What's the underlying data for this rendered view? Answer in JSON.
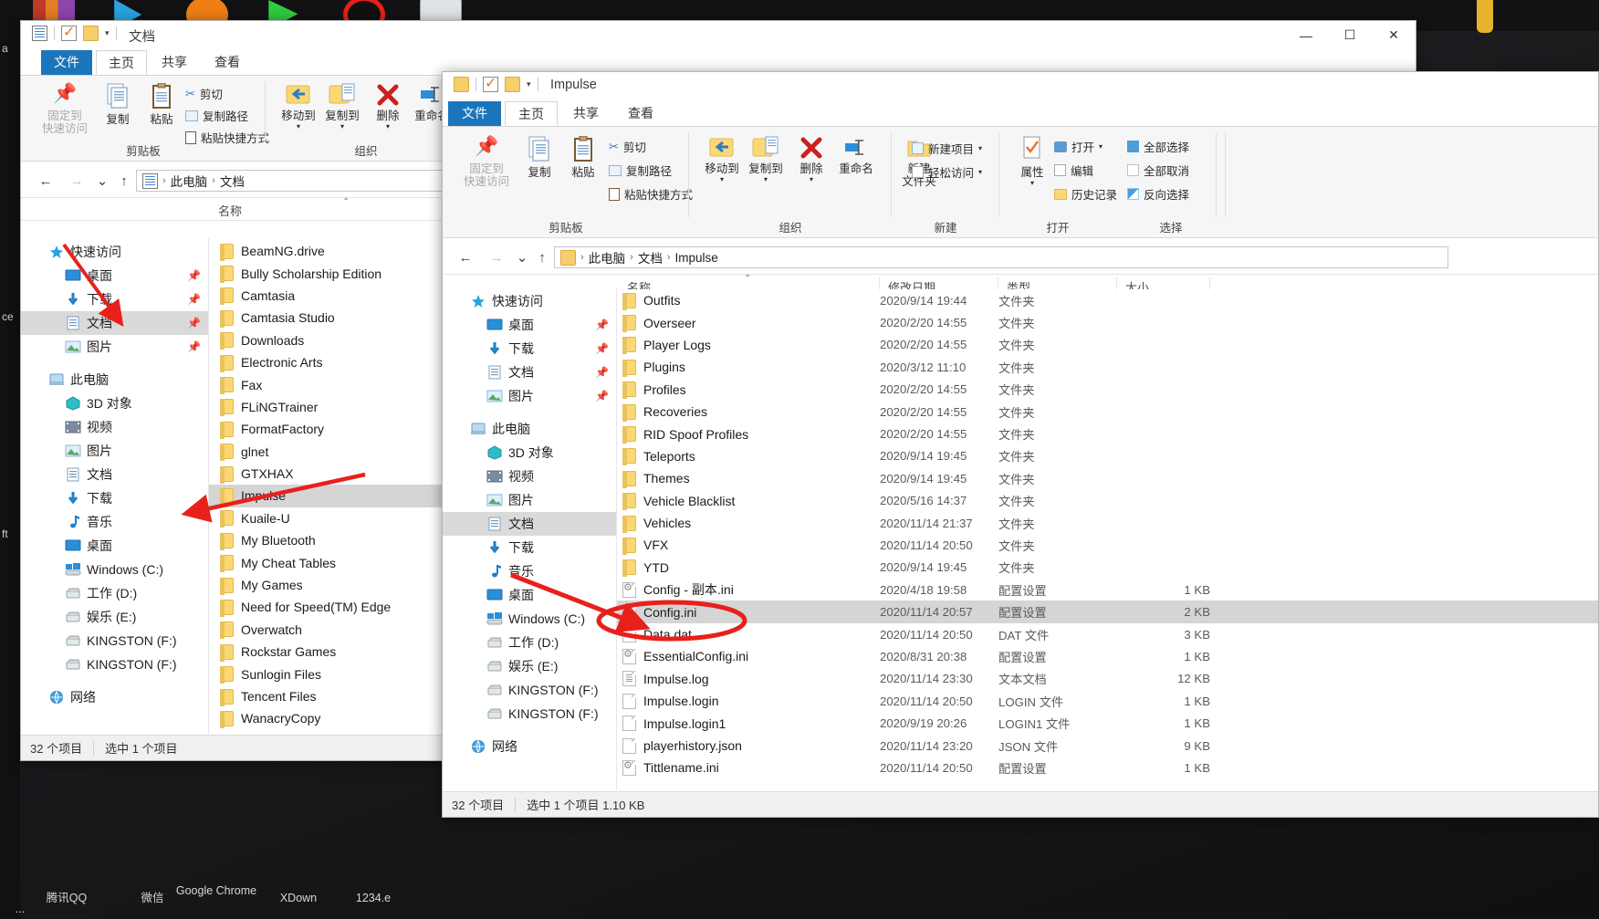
{
  "desktop": {
    "taskbar_items": [
      {
        "label": "腾讯QQ"
      },
      {
        "label": "微信"
      },
      {
        "label": "Google Chrome"
      },
      {
        "label": "XDown"
      },
      {
        "label": "1234.e"
      },
      {
        "label": "..."
      }
    ],
    "side_labels": [
      "a",
      "ce",
      "ft"
    ]
  },
  "window_left": {
    "title": "文档",
    "qat_icons": [
      "document-icon",
      "checkbox-icon",
      "folder-icon",
      "chevron-down-icon"
    ],
    "window_buttons": {
      "minimize": "—",
      "maximize": "☐",
      "close": "✕"
    },
    "tabs": [
      {
        "label": "文件",
        "type": "file"
      },
      {
        "label": "主页",
        "type": "active"
      },
      {
        "label": "共享",
        "type": "normal"
      },
      {
        "label": "查看",
        "type": "normal"
      }
    ],
    "ribbon": {
      "groups": [
        {
          "name": "剪贴板",
          "big_buttons": [
            {
              "label": "固定到\n快速访问",
              "icon": "pin-icon",
              "disabled": true
            },
            {
              "label": "复制",
              "icon": "copy-icon"
            },
            {
              "label": "粘贴",
              "icon": "paste-icon"
            }
          ],
          "small_buttons": [
            {
              "label": "剪切",
              "icon": "scissors-icon"
            },
            {
              "label": "复制路径",
              "icon": "copy-path-icon"
            },
            {
              "label": "粘贴快捷方式",
              "icon": "paste-shortcut-icon"
            }
          ]
        },
        {
          "name": "组织",
          "big_buttons": [
            {
              "label": "移动到",
              "icon": "move-to-icon"
            },
            {
              "label": "复制到",
              "icon": "copy-to-icon"
            },
            {
              "label": "删除",
              "icon": "delete-icon"
            },
            {
              "label": "重命名",
              "icon": "rename-icon"
            }
          ],
          "small_buttons": []
        }
      ]
    },
    "breadcrumb": {
      "root_icon": "computer-icon",
      "segments": [
        "此电脑",
        "文档"
      ]
    },
    "nav_buttons": {
      "back": "←",
      "forward": "→",
      "recent": "⌄",
      "up": "↑"
    },
    "columns": [
      {
        "label": "名称"
      }
    ],
    "nav_pane": [
      {
        "label": "快速访问",
        "icon": "star-icon",
        "level": 0,
        "pinned": false,
        "selected": false
      },
      {
        "label": "桌面",
        "icon": "desktop-icon",
        "level": 1,
        "pinned": true,
        "selected": false
      },
      {
        "label": "下载",
        "icon": "download-icon",
        "level": 1,
        "pinned": true,
        "selected": false
      },
      {
        "label": "文档",
        "icon": "documents-icon",
        "level": 1,
        "pinned": true,
        "selected": true
      },
      {
        "label": "图片",
        "icon": "pictures-icon",
        "level": 1,
        "pinned": true,
        "selected": false
      },
      {
        "label": "此电脑",
        "icon": "computer-icon",
        "level": 0,
        "pinned": false,
        "selected": false
      },
      {
        "label": "3D 对象",
        "icon": "3d-objects-icon",
        "level": 1,
        "pinned": false,
        "selected": false
      },
      {
        "label": "视频",
        "icon": "videos-icon",
        "level": 1,
        "pinned": false,
        "selected": false
      },
      {
        "label": "图片",
        "icon": "pictures-icon",
        "level": 1,
        "pinned": false,
        "selected": false
      },
      {
        "label": "文档",
        "icon": "documents-icon",
        "level": 1,
        "pinned": false,
        "selected": false
      },
      {
        "label": "下载",
        "icon": "download-icon",
        "level": 1,
        "pinned": false,
        "selected": false
      },
      {
        "label": "音乐",
        "icon": "music-icon",
        "level": 1,
        "pinned": false,
        "selected": false
      },
      {
        "label": "桌面",
        "icon": "desktop-icon",
        "level": 1,
        "pinned": false,
        "selected": false
      },
      {
        "label": "Windows (C:)",
        "icon": "windows-drive-icon",
        "level": 1,
        "pinned": false,
        "selected": false
      },
      {
        "label": "工作 (D:)",
        "icon": "drive-icon",
        "level": 1,
        "pinned": false,
        "selected": false
      },
      {
        "label": "娱乐 (E:)",
        "icon": "drive-icon",
        "level": 1,
        "pinned": false,
        "selected": false
      },
      {
        "label": "KINGSTON (F:)",
        "icon": "drive-icon",
        "level": 1,
        "pinned": false,
        "selected": false
      },
      {
        "label": "KINGSTON (F:)",
        "icon": "drive-icon",
        "level": 1,
        "pinned": false,
        "selected": false
      },
      {
        "label": "网络",
        "icon": "network-icon",
        "level": 0,
        "pinned": false,
        "selected": false
      }
    ],
    "files": [
      {
        "name": "BeamNG.drive",
        "icon": "folder",
        "selected": false
      },
      {
        "name": "Bully Scholarship Edition",
        "icon": "folder",
        "selected": false
      },
      {
        "name": "Camtasia",
        "icon": "folder",
        "selected": false
      },
      {
        "name": "Camtasia Studio",
        "icon": "folder",
        "selected": false
      },
      {
        "name": "Downloads",
        "icon": "folder",
        "selected": false
      },
      {
        "name": "Electronic Arts",
        "icon": "folder",
        "selected": false
      },
      {
        "name": "Fax",
        "icon": "folder",
        "selected": false
      },
      {
        "name": "FLiNGTrainer",
        "icon": "folder",
        "selected": false
      },
      {
        "name": "FormatFactory",
        "icon": "folder",
        "selected": false
      },
      {
        "name": "glnet",
        "icon": "folder",
        "selected": false
      },
      {
        "name": "GTXHAX",
        "icon": "folder",
        "selected": false
      },
      {
        "name": "Impulse",
        "icon": "folder",
        "selected": true
      },
      {
        "name": "Kuaile-U",
        "icon": "folder",
        "selected": false
      },
      {
        "name": "My Bluetooth",
        "icon": "folder",
        "selected": false
      },
      {
        "name": "My Cheat Tables",
        "icon": "folder",
        "selected": false
      },
      {
        "name": "My Games",
        "icon": "folder",
        "selected": false
      },
      {
        "name": "Need for Speed(TM) Edge",
        "icon": "folder",
        "selected": false
      },
      {
        "name": "Overwatch",
        "icon": "folder",
        "selected": false
      },
      {
        "name": "Rockstar Games",
        "icon": "folder",
        "selected": false
      },
      {
        "name": "Sunlogin Files",
        "icon": "folder",
        "selected": false
      },
      {
        "name": "Tencent Files",
        "icon": "folder",
        "selected": false
      },
      {
        "name": "WanacryCopy",
        "icon": "folder",
        "selected": false
      }
    ],
    "status": {
      "count": "32 个项目",
      "selection": "选中 1 个项目"
    }
  },
  "window_right": {
    "title": "Impulse",
    "qat_icons": [
      "folder-icon",
      "checkbox-icon",
      "folder-icon",
      "chevron-down-icon"
    ],
    "tabs": [
      {
        "label": "文件",
        "type": "file"
      },
      {
        "label": "主页",
        "type": "active"
      },
      {
        "label": "共享",
        "type": "normal"
      },
      {
        "label": "查看",
        "type": "normal"
      }
    ],
    "ribbon": {
      "groups": [
        {
          "name": "剪贴板",
          "big_buttons": [
            {
              "label": "固定到\n快速访问",
              "icon": "pin-icon",
              "disabled": true
            },
            {
              "label": "复制",
              "icon": "copy-icon"
            },
            {
              "label": "粘贴",
              "icon": "paste-icon"
            }
          ],
          "small_buttons": [
            {
              "label": "剪切",
              "icon": "scissors-icon"
            },
            {
              "label": "复制路径",
              "icon": "copy-path-icon"
            },
            {
              "label": "粘贴快捷方式",
              "icon": "paste-shortcut-icon"
            }
          ]
        },
        {
          "name": "组织",
          "big_buttons": [
            {
              "label": "移动到",
              "icon": "move-to-icon"
            },
            {
              "label": "复制到",
              "icon": "copy-to-icon"
            },
            {
              "label": "删除",
              "icon": "delete-icon"
            },
            {
              "label": "重命名",
              "icon": "rename-icon"
            }
          ],
          "small_buttons": []
        },
        {
          "name": "新建",
          "big_buttons": [
            {
              "label": "新建\n文件夹",
              "icon": "new-folder-icon"
            }
          ],
          "small_buttons": [
            {
              "label": "新建项目",
              "icon": "new-item-icon",
              "caret": true
            },
            {
              "label": "轻松访问",
              "icon": "easy-access-icon",
              "caret": true
            }
          ]
        },
        {
          "name": "打开",
          "big_buttons": [
            {
              "label": "属性",
              "icon": "properties-icon"
            }
          ],
          "small_buttons": [
            {
              "label": "打开",
              "icon": "open-icon",
              "caret": true
            },
            {
              "label": "编辑",
              "icon": "edit-icon"
            },
            {
              "label": "历史记录",
              "icon": "history-icon"
            }
          ]
        },
        {
          "name": "选择",
          "big_buttons": [],
          "small_buttons": [
            {
              "label": "全部选择",
              "icon": "select-all-icon"
            },
            {
              "label": "全部取消",
              "icon": "select-none-icon"
            },
            {
              "label": "反向选择",
              "icon": "invert-selection-icon"
            }
          ]
        }
      ]
    },
    "breadcrumb": {
      "root_icon": "folder-icon",
      "segments": [
        "此电脑",
        "文档",
        "Impulse"
      ]
    },
    "nav_buttons": {
      "back": "←",
      "forward": "→",
      "recent": "⌄",
      "up": "↑"
    },
    "columns": [
      {
        "label": "名称"
      },
      {
        "label": "修改日期"
      },
      {
        "label": "类型"
      },
      {
        "label": "大小"
      }
    ],
    "nav_pane": [
      {
        "label": "快速访问",
        "icon": "star-icon",
        "level": 0,
        "pinned": false,
        "selected": false
      },
      {
        "label": "桌面",
        "icon": "desktop-icon",
        "level": 1,
        "pinned": true,
        "selected": false
      },
      {
        "label": "下载",
        "icon": "download-icon",
        "level": 1,
        "pinned": true,
        "selected": false
      },
      {
        "label": "文档",
        "icon": "documents-icon",
        "level": 1,
        "pinned": true,
        "selected": false
      },
      {
        "label": "图片",
        "icon": "pictures-icon",
        "level": 1,
        "pinned": true,
        "selected": false
      },
      {
        "label": "此电脑",
        "icon": "computer-icon",
        "level": 0,
        "pinned": false,
        "selected": false
      },
      {
        "label": "3D 对象",
        "icon": "3d-objects-icon",
        "level": 1,
        "pinned": false,
        "selected": false
      },
      {
        "label": "视频",
        "icon": "videos-icon",
        "level": 1,
        "pinned": false,
        "selected": false
      },
      {
        "label": "图片",
        "icon": "pictures-icon",
        "level": 1,
        "pinned": false,
        "selected": false
      },
      {
        "label": "文档",
        "icon": "documents-icon",
        "level": 1,
        "pinned": false,
        "selected": true
      },
      {
        "label": "下载",
        "icon": "download-icon",
        "level": 1,
        "pinned": false,
        "selected": false
      },
      {
        "label": "音乐",
        "icon": "music-icon",
        "level": 1,
        "pinned": false,
        "selected": false
      },
      {
        "label": "桌面",
        "icon": "desktop-icon",
        "level": 1,
        "pinned": false,
        "selected": false
      },
      {
        "label": "Windows (C:)",
        "icon": "windows-drive-icon",
        "level": 1,
        "pinned": false,
        "selected": false
      },
      {
        "label": "工作 (D:)",
        "icon": "drive-icon",
        "level": 1,
        "pinned": false,
        "selected": false
      },
      {
        "label": "娱乐 (E:)",
        "icon": "drive-icon",
        "level": 1,
        "pinned": false,
        "selected": false
      },
      {
        "label": "KINGSTON (F:)",
        "icon": "drive-icon",
        "level": 1,
        "pinned": false,
        "selected": false
      },
      {
        "label": "KINGSTON (F:)",
        "icon": "drive-icon",
        "level": 1,
        "pinned": false,
        "selected": false
      },
      {
        "label": "网络",
        "icon": "network-icon",
        "level": 0,
        "pinned": false,
        "selected": false
      }
    ],
    "files": [
      {
        "name": "Outfits",
        "date": "2020/9/14 19:44",
        "type": "文件夹",
        "size": "",
        "icon": "folder",
        "selected": false
      },
      {
        "name": "Overseer",
        "date": "2020/2/20 14:55",
        "type": "文件夹",
        "size": "",
        "icon": "folder",
        "selected": false
      },
      {
        "name": "Player Logs",
        "date": "2020/2/20 14:55",
        "type": "文件夹",
        "size": "",
        "icon": "folder",
        "selected": false
      },
      {
        "name": "Plugins",
        "date": "2020/3/12 11:10",
        "type": "文件夹",
        "size": "",
        "icon": "folder",
        "selected": false
      },
      {
        "name": "Profiles",
        "date": "2020/2/20 14:55",
        "type": "文件夹",
        "size": "",
        "icon": "folder",
        "selected": false
      },
      {
        "name": "Recoveries",
        "date": "2020/2/20 14:55",
        "type": "文件夹",
        "size": "",
        "icon": "folder",
        "selected": false
      },
      {
        "name": "RID Spoof Profiles",
        "date": "2020/2/20 14:55",
        "type": "文件夹",
        "size": "",
        "icon": "folder",
        "selected": false
      },
      {
        "name": "Teleports",
        "date": "2020/9/14 19:45",
        "type": "文件夹",
        "size": "",
        "icon": "folder",
        "selected": false
      },
      {
        "name": "Themes",
        "date": "2020/9/14 19:45",
        "type": "文件夹",
        "size": "",
        "icon": "folder",
        "selected": false
      },
      {
        "name": "Vehicle Blacklist",
        "date": "2020/5/16 14:37",
        "type": "文件夹",
        "size": "",
        "icon": "folder",
        "selected": false
      },
      {
        "name": "Vehicles",
        "date": "2020/11/14 21:37",
        "type": "文件夹",
        "size": "",
        "icon": "folder",
        "selected": false
      },
      {
        "name": "VFX",
        "date": "2020/11/14 20:50",
        "type": "文件夹",
        "size": "",
        "icon": "folder",
        "selected": false
      },
      {
        "name": "YTD",
        "date": "2020/9/14 19:45",
        "type": "文件夹",
        "size": "",
        "icon": "folder",
        "selected": false
      },
      {
        "name": "Config - 副本.ini",
        "date": "2020/4/18 19:58",
        "type": "配置设置",
        "size": "1 KB",
        "icon": "ini",
        "selected": false
      },
      {
        "name": "Config.ini",
        "date": "2020/11/14 20:57",
        "type": "配置设置",
        "size": "2 KB",
        "icon": "ini",
        "selected": true
      },
      {
        "name": "Data.dat",
        "date": "2020/11/14 20:50",
        "type": "DAT 文件",
        "size": "3 KB",
        "icon": "file",
        "selected": false
      },
      {
        "name": "EssentialConfig.ini",
        "date": "2020/8/31 20:38",
        "type": "配置设置",
        "size": "1 KB",
        "icon": "ini",
        "selected": false
      },
      {
        "name": "Impulse.log",
        "date": "2020/11/14 23:30",
        "type": "文本文档",
        "size": "12 KB",
        "icon": "txt",
        "selected": false
      },
      {
        "name": "Impulse.login",
        "date": "2020/11/14 20:50",
        "type": "LOGIN 文件",
        "size": "1 KB",
        "icon": "file",
        "selected": false
      },
      {
        "name": "Impulse.login1",
        "date": "2020/9/19 20:26",
        "type": "LOGIN1 文件",
        "size": "1 KB",
        "icon": "file",
        "selected": false
      },
      {
        "name": "playerhistory.json",
        "date": "2020/11/14 23:20",
        "type": "JSON 文件",
        "size": "9 KB",
        "icon": "file",
        "selected": false
      },
      {
        "name": "Tittlename.ini",
        "date": "2020/11/14 20:50",
        "type": "配置设置",
        "size": "1 KB",
        "icon": "ini",
        "selected": false
      }
    ],
    "status": {
      "count": "32 个项目",
      "selection": "选中 1 个项目 1.10 KB"
    }
  },
  "annotations": {
    "accent_color": "#e8201b",
    "arrow1_name": "arrow-to-documents",
    "arrow2_name": "arrow-to-impulse",
    "arrow3_name": "arrow-to-config-ini",
    "ellipse_name": "highlight-ellipse-config-ini"
  }
}
